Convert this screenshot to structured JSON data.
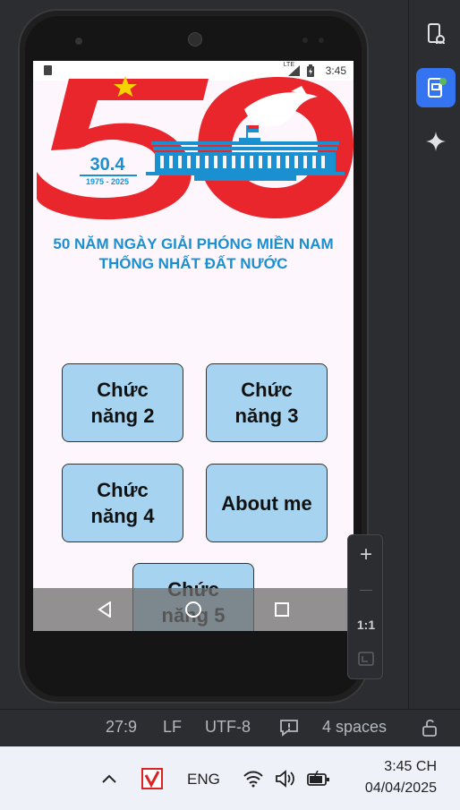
{
  "device": {
    "status_time": "3:45",
    "network_label": "LTE"
  },
  "app": {
    "banner": {
      "number": "50",
      "date": "30.4",
      "years": "1975 - 2025",
      "title_line1": "50 NĂM NGÀY GIẢI PHÓNG MIỀN NAM",
      "title_line2": "THỐNG NHẤT ĐẤT NƯỚC"
    },
    "buttons": [
      {
        "label": "Chức năng 2"
      },
      {
        "label": "Chức năng 3"
      },
      {
        "label": "Chức năng 4"
      },
      {
        "label": "About me"
      },
      {
        "label": "Chức năng 5"
      }
    ],
    "colors": {
      "button_bg": "#a6d4f0",
      "banner_red": "#e8262c",
      "banner_blue": "#1a90d0",
      "star_yellow": "#f6d200"
    }
  },
  "emulator_controls": {
    "zoom_in": "+",
    "zoom_out": "—",
    "ratio": "1:1"
  },
  "ide_status": {
    "position": "27:9",
    "line_ending": "LF",
    "encoding": "UTF-8",
    "indent": "4 spaces"
  },
  "taskbar": {
    "language": "ENG",
    "time": "3:45 CH",
    "date": "04/04/2025"
  }
}
